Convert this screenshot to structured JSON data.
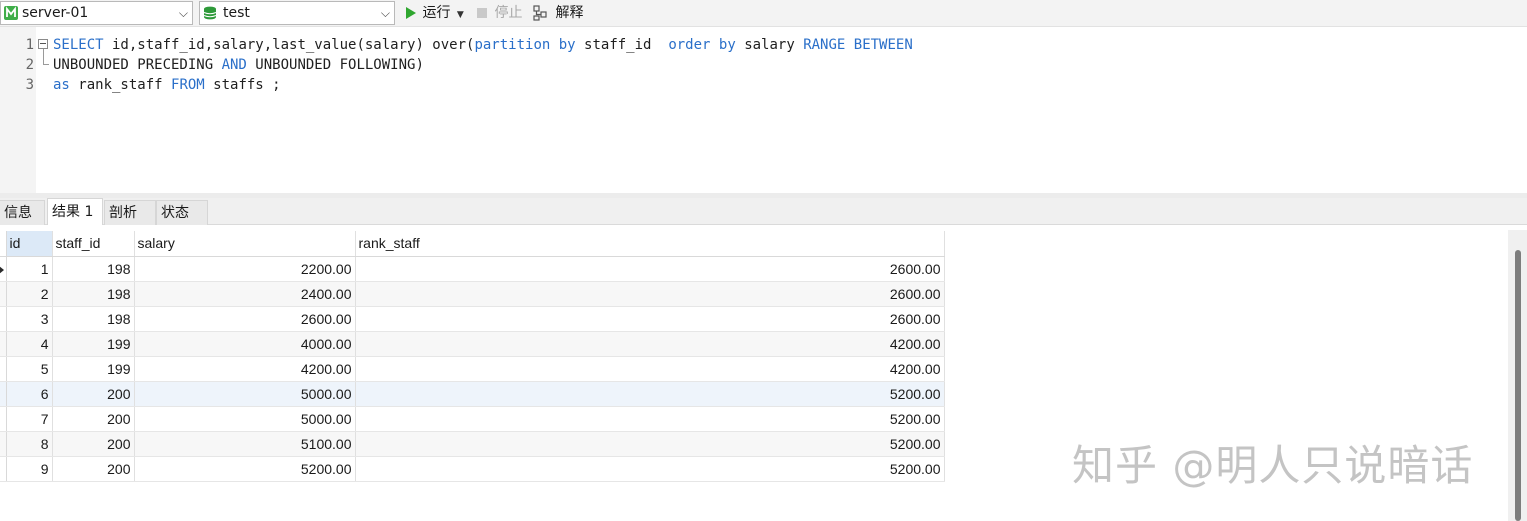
{
  "toolbar": {
    "connection": "server-01",
    "database": "test",
    "run_label": "运行",
    "stop_label": "停止",
    "explain_label": "解释"
  },
  "editor": {
    "line_numbers": [
      "1",
      "2",
      "3"
    ],
    "lines": [
      [
        {
          "t": "SELECT",
          "kw": true
        },
        {
          "t": " id,staff_id,salary,last_value(salary) over(",
          "kw": false
        },
        {
          "t": "partition by",
          "kw": true
        },
        {
          "t": " staff_id  ",
          "kw": false
        },
        {
          "t": "order by",
          "kw": true
        },
        {
          "t": " salary ",
          "kw": false
        },
        {
          "t": "RANGE BETWEEN",
          "kw": true
        }
      ],
      [
        {
          "t": "UNBOUNDED PRECEDING ",
          "kw": false
        },
        {
          "t": "AND",
          "kw": true
        },
        {
          "t": " UNBOUNDED FOLLOWING)",
          "kw": false
        }
      ],
      [
        {
          "t": "as",
          "kw": true
        },
        {
          "t": " rank_staff ",
          "kw": false
        },
        {
          "t": "FROM",
          "kw": true
        },
        {
          "t": " staffs ;",
          "kw": false
        }
      ]
    ]
  },
  "tabs": [
    "信息",
    "结果 1",
    "剖析",
    "状态"
  ],
  "result": {
    "columns": [
      "id",
      "staff_id",
      "salary",
      "rank_staff"
    ],
    "rows": [
      [
        "1",
        "198",
        "2200.00",
        "2600.00"
      ],
      [
        "2",
        "198",
        "2400.00",
        "2600.00"
      ],
      [
        "3",
        "198",
        "2600.00",
        "2600.00"
      ],
      [
        "4",
        "199",
        "4000.00",
        "4200.00"
      ],
      [
        "5",
        "199",
        "4200.00",
        "4200.00"
      ],
      [
        "6",
        "200",
        "5000.00",
        "5200.00"
      ],
      [
        "7",
        "200",
        "5000.00",
        "5200.00"
      ],
      [
        "8",
        "200",
        "5100.00",
        "5200.00"
      ],
      [
        "9",
        "200",
        "5200.00",
        "5200.00"
      ]
    ]
  },
  "watermark": "知乎 @明人只说暗话"
}
